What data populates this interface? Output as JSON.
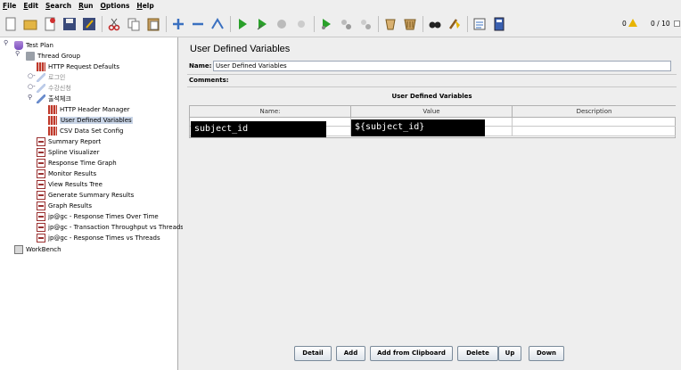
{
  "menu": [
    {
      "first": "F",
      "rest": "ile"
    },
    {
      "first": "E",
      "rest": "dit"
    },
    {
      "first": "S",
      "rest": "earch"
    },
    {
      "first": "R",
      "rest": "un"
    },
    {
      "first": "O",
      "rest": "ptions"
    },
    {
      "first": "H",
      "rest": "elp"
    }
  ],
  "status": {
    "errors": "0",
    "threads": "0 / 10"
  },
  "tree": {
    "test_plan": "Test Plan",
    "thread_group": "Thread Group",
    "http_defaults": "HTTP Request Defaults",
    "sampler_1": "로그인",
    "sampler_2": "수강신청",
    "sampler_3": "출석체크",
    "header_manager": "HTTP Header Manager",
    "udv": "User Defined Variables",
    "csv": "CSV Data Set Config",
    "listeners": [
      "Summary Report",
      "Spline Visualizer",
      "Response Time Graph",
      "Monitor Results",
      "View Results Tree",
      "Generate Summary Results",
      "Graph Results",
      "jp@gc - Response Times Over Time",
      "jp@gc - Transaction Throughput vs Threads",
      "jp@gc - Response Times vs Threads"
    ],
    "workbench": "WorkBench"
  },
  "panel": {
    "title": "User Defined Variables",
    "name_label": "Name:",
    "name_value": "User Defined Variables",
    "comments_label": "Comments:",
    "table_caption": "User Defined Variables",
    "columns": [
      "Name:",
      "Value",
      "Description"
    ],
    "rows": [
      {
        "name": "subject_id",
        "value": "${subject_id}",
        "description": ""
      }
    ]
  },
  "buttons": {
    "detail": "Detail",
    "add": "Add",
    "add_clipboard": "Add from Clipboard",
    "delete": "Delete",
    "up": "Up",
    "down": "Down"
  },
  "colors": {
    "selection": "#c8d4e6",
    "warning": "#e8b400",
    "config_icon": "#c0392b"
  }
}
